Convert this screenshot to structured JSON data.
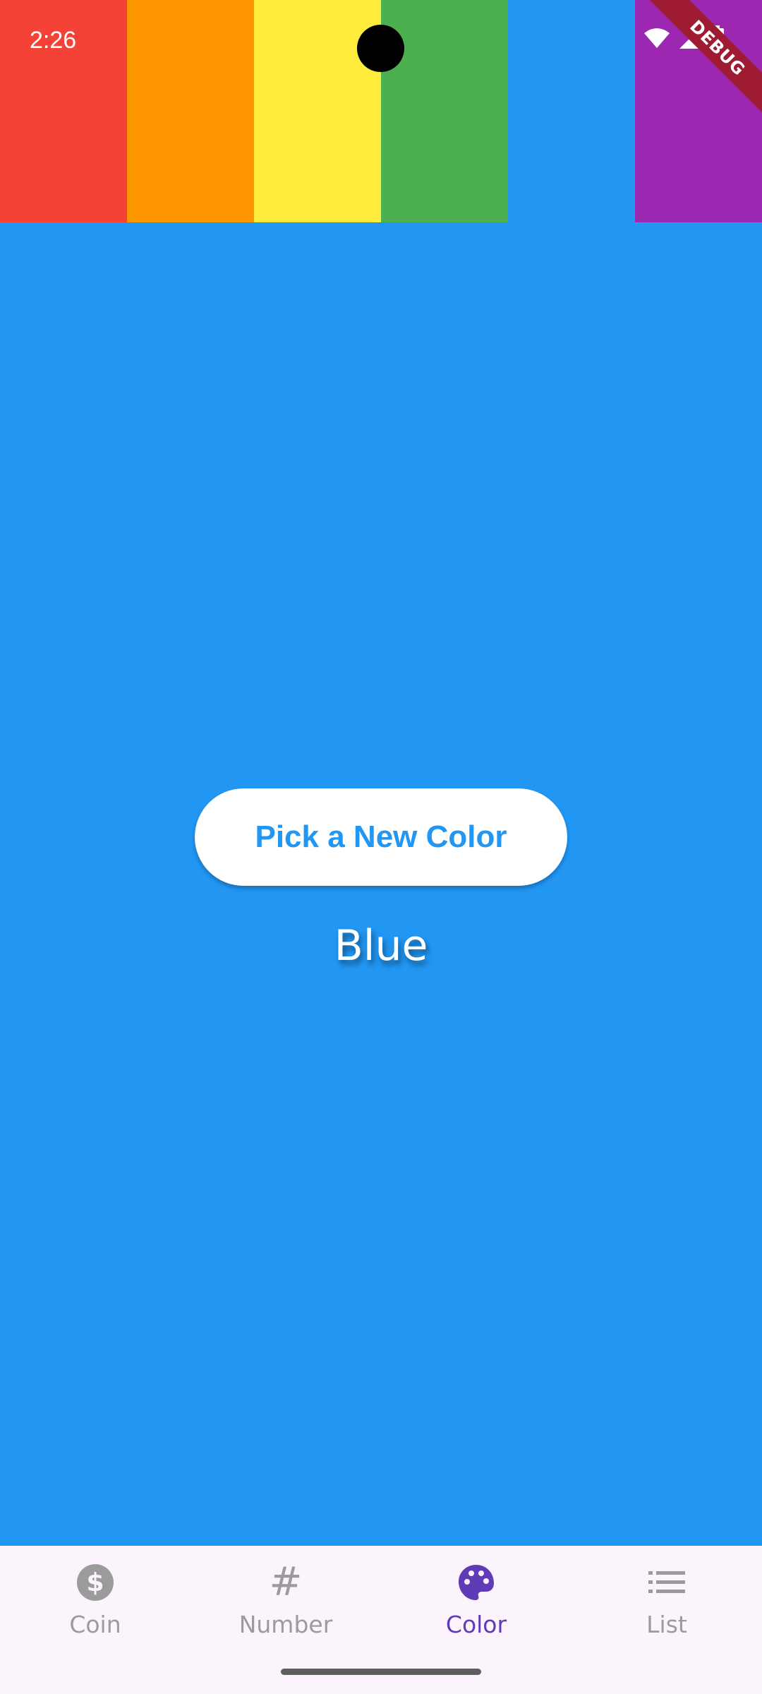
{
  "status_bar": {
    "time": "2:26",
    "icons": [
      "wifi-icon",
      "signal-icon",
      "battery-icon"
    ]
  },
  "debug_banner": {
    "label": "DEBUG",
    "color": "#9E1B32"
  },
  "rainbow": [
    "#F44336",
    "#FF9800",
    "#FFEB3B",
    "#4CAF50",
    "#2196F3",
    "#9C27B0"
  ],
  "background_color": "#2196F3",
  "main": {
    "button_label": "Pick a New Color",
    "color_name": "Blue"
  },
  "nav": {
    "active": "Color",
    "active_color": "#5F3BB5",
    "inactive_color": "#9B9B9B",
    "items": [
      {
        "label": "Coin",
        "icon": "dollar-icon"
      },
      {
        "label": "Number",
        "icon": "hash-icon"
      },
      {
        "label": "Color",
        "icon": "palette-icon"
      },
      {
        "label": "List",
        "icon": "list-icon"
      }
    ]
  }
}
